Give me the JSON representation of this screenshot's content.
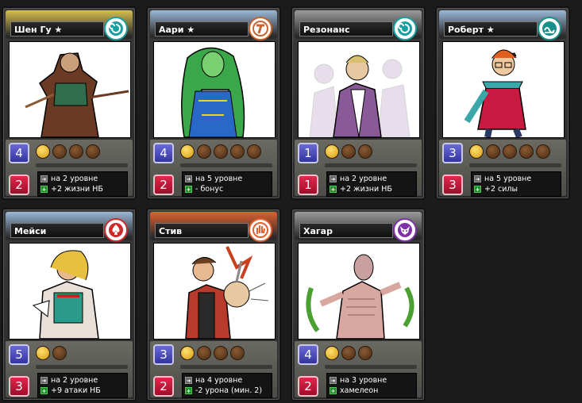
{
  "colors": {
    "power_bg": "#4a4ac0",
    "damage_bg": "#c8183c",
    "pill_filled": "#f0b820",
    "pill_empty": "#6a3e1e"
  },
  "cards": [
    {
      "name": "Шен Гу ★",
      "power": "4",
      "damage": "2",
      "level_text": "на 2 уровне",
      "bonus_text": "+2 жизни НБ",
      "filled_pills": 1,
      "total_pills": 4,
      "clan_icon": "spiral-icon",
      "frame_color": "#d8c050",
      "clan_color": "#18a0a0",
      "art": "Shen Gu"
    },
    {
      "name": "Аари ★",
      "power": "4",
      "damage": "2",
      "level_text": "на 5 уровне",
      "bonus_text": "- бонус",
      "filled_pills": 1,
      "total_pills": 5,
      "clan_icon": "t-rune-icon",
      "frame_color": "#9ab8d8",
      "clan_color": "#c86430",
      "art": "Aari"
    },
    {
      "name": "Резонанс",
      "power": "1",
      "damage": "1",
      "level_text": "на 2 уровне",
      "bonus_text": "+2 жизни НБ",
      "filled_pills": 1,
      "total_pills": 3,
      "clan_icon": "spiral-icon",
      "frame_color": "#9a9a9a",
      "clan_color": "#18a0a0",
      "art": "Resonance"
    },
    {
      "name": "Роберт ★",
      "power": "3",
      "damage": "3",
      "level_text": "на 5 уровне",
      "bonus_text": "+2 силы",
      "filled_pills": 1,
      "total_pills": 5,
      "clan_icon": "wave-icon",
      "frame_color": "#9ab8d8",
      "clan_color": "#18908a",
      "art": "Robert"
    },
    {
      "name": "Мейси",
      "power": "5",
      "damage": "3",
      "level_text": "на 2 уровне",
      "bonus_text": "+9 атаки НБ",
      "filled_pills": 1,
      "total_pills": 2,
      "clan_icon": "spade-icon",
      "frame_color": "#9ab8d8",
      "clan_color": "#d02828",
      "art": "Macy"
    },
    {
      "name": "Стив",
      "power": "3",
      "damage": "2",
      "level_text": "на 4 уровне",
      "bonus_text": "-2 урона (мин. 2)",
      "filled_pills": 1,
      "total_pills": 4,
      "clan_icon": "grab-hand-icon",
      "frame_color": "#e06030",
      "clan_color": "#e06030",
      "art": "Steve"
    },
    {
      "name": "Хагар",
      "power": "4",
      "damage": "2",
      "level_text": "на 3 уровне",
      "bonus_text": "хамелеон",
      "filled_pills": 1,
      "total_pills": 3,
      "clan_icon": "horned-mask-icon",
      "frame_color": "#9a9a9a",
      "clan_color": "#8030a8",
      "art": "Hagar"
    }
  ]
}
